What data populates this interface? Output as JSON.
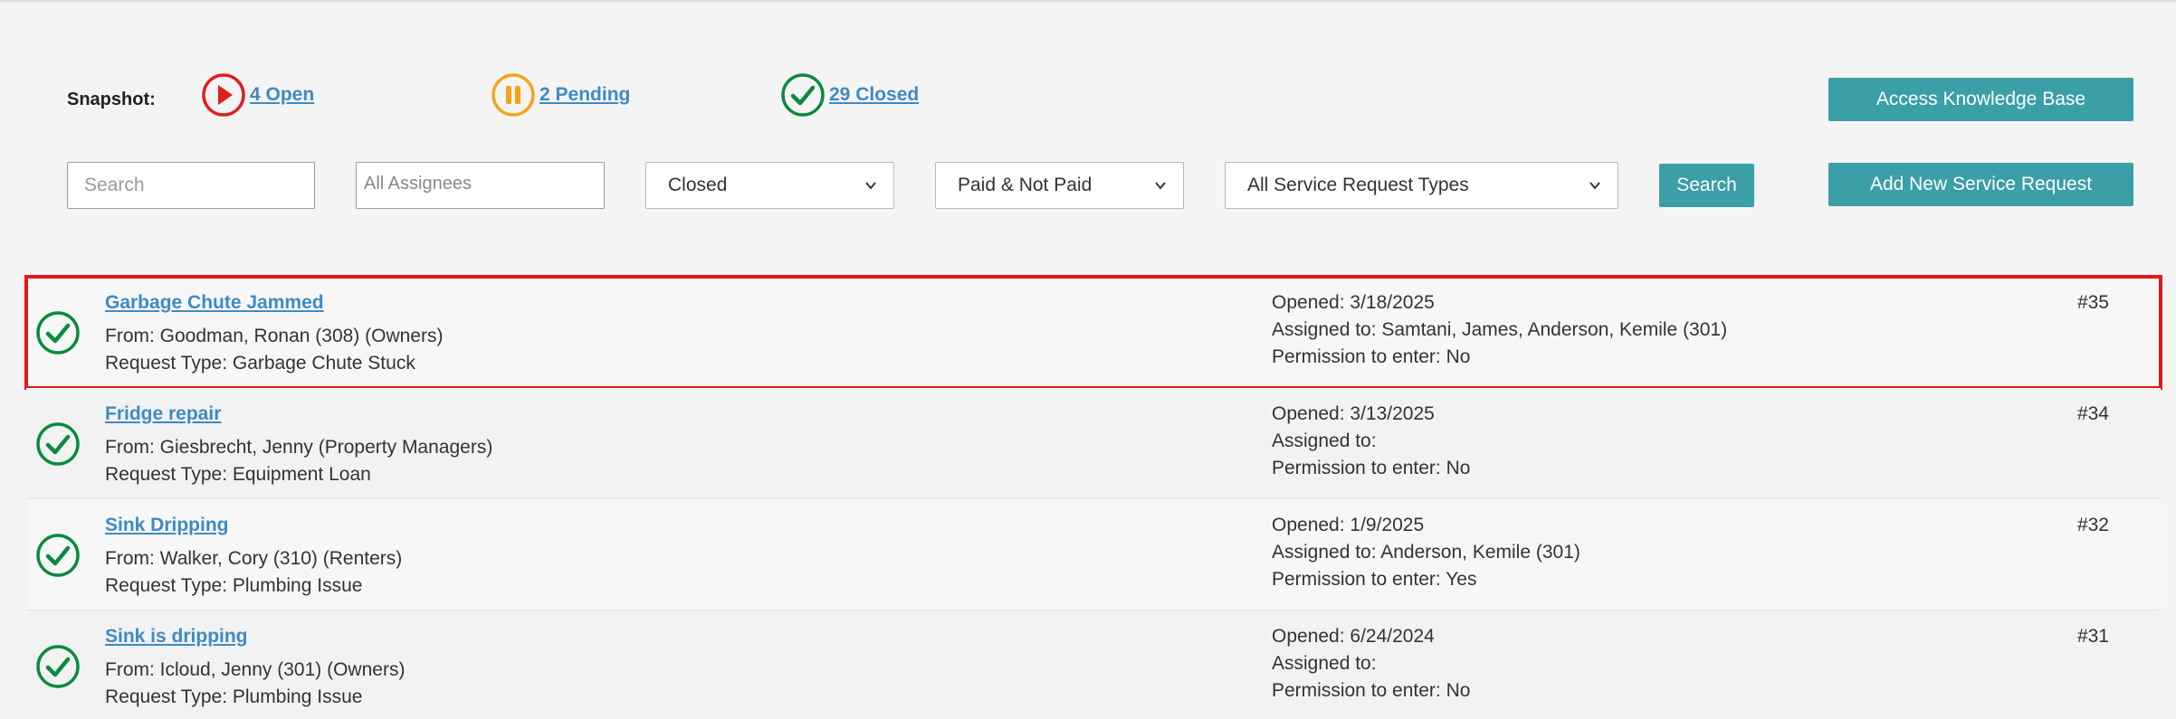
{
  "snapshot": {
    "label": "Snapshot:",
    "open_label": "4 Open",
    "pending_label": "2 Pending",
    "closed_label": "29 Closed"
  },
  "actions": {
    "knowledge_base_label": "Access Knowledge Base",
    "add_request_label": "Add New Service Request",
    "search_button_label": "Search"
  },
  "filters": {
    "search_placeholder": "Search",
    "assignees_placeholder": "All Assignees",
    "status_value": "Closed",
    "paid_value": "Paid & Not Paid",
    "type_value": "All Service Request Types"
  },
  "colors": {
    "accent_teal": "#3a9fa6",
    "link_blue": "#3d8bc4",
    "open_red": "#e01e1e",
    "pending_orange": "#f2a51c",
    "closed_green": "#0b8a3e",
    "highlight_red": "#e11919"
  },
  "requests": [
    {
      "title": "Garbage Chute Jammed",
      "from": "From: Goodman, Ronan (308) (Owners)",
      "type": "Request Type: Garbage Chute Stuck",
      "opened": "Opened: 3/18/2025",
      "assigned": "Assigned to: Samtani, James, Anderson, Kemile (301)",
      "permission": "Permission to enter: No",
      "number": "#35",
      "status_icon": "check-circle-icon"
    },
    {
      "title": "Fridge repair",
      "from": "From: Giesbrecht, Jenny (Property Managers)",
      "type": "Request Type: Equipment Loan",
      "opened": "Opened: 3/13/2025",
      "assigned": "Assigned to:",
      "permission": "Permission to enter: No",
      "number": "#34",
      "status_icon": "check-circle-icon"
    },
    {
      "title": "Sink Dripping",
      "from": "From: Walker, Cory (310) (Renters)",
      "type": "Request Type: Plumbing Issue",
      "opened": "Opened: 1/9/2025",
      "assigned": "Assigned to: Anderson, Kemile (301)",
      "permission": "Permission to enter: Yes",
      "number": "#32",
      "status_icon": "check-circle-icon"
    },
    {
      "title": "Sink is dripping",
      "from": "From: Icloud, Jenny (301) (Owners)",
      "type": "Request Type: Plumbing Issue",
      "opened": "Opened: 6/24/2024",
      "assigned": "Assigned to:",
      "permission": "Permission to enter: No",
      "number": "#31",
      "status_icon": "check-circle-icon"
    }
  ]
}
